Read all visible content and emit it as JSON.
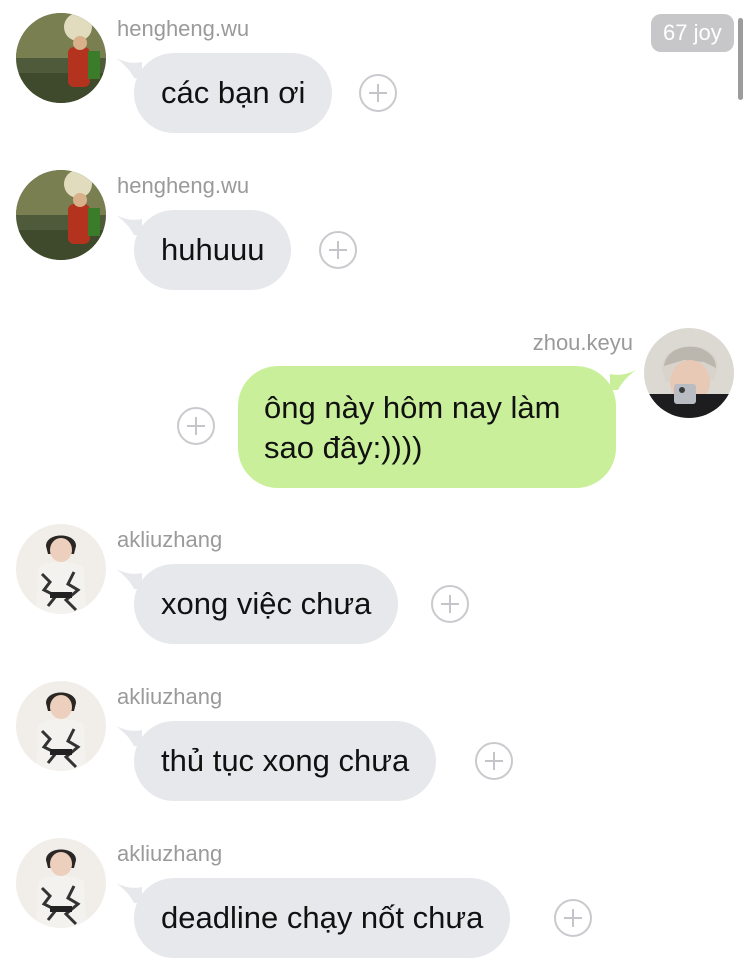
{
  "badge": {
    "text": "67 joy"
  },
  "messages": [
    {
      "sender": "hengheng.wu",
      "text": "các bạn ơi",
      "direction": "incoming",
      "avatar": "hengheng-avatar"
    },
    {
      "sender": "hengheng.wu",
      "text": "huhuuu",
      "direction": "incoming",
      "avatar": "hengheng-avatar"
    },
    {
      "sender": "zhou.keyu",
      "text": "ông này hôm nay làm sao đây:))))",
      "direction": "outgoing",
      "avatar": "zhou-avatar"
    },
    {
      "sender": "akliuzhang",
      "text": "xong việc chưa",
      "direction": "incoming",
      "avatar": "akliuzhang-avatar"
    },
    {
      "sender": "akliuzhang",
      "text": "thủ tục xong chưa",
      "direction": "incoming",
      "avatar": "akliuzhang-avatar"
    },
    {
      "sender": "akliuzhang",
      "text": "deadline chạy nốt chưa",
      "direction": "incoming",
      "avatar": "akliuzhang-avatar"
    }
  ],
  "icons": {
    "react": "add-reaction-icon"
  },
  "colors": {
    "incoming_bubble": "#e7e8ec",
    "outgoing_bubble": "#c9ef9b",
    "sender_name": "#9a9a9a",
    "badge_bg": "#c7c7c9"
  }
}
